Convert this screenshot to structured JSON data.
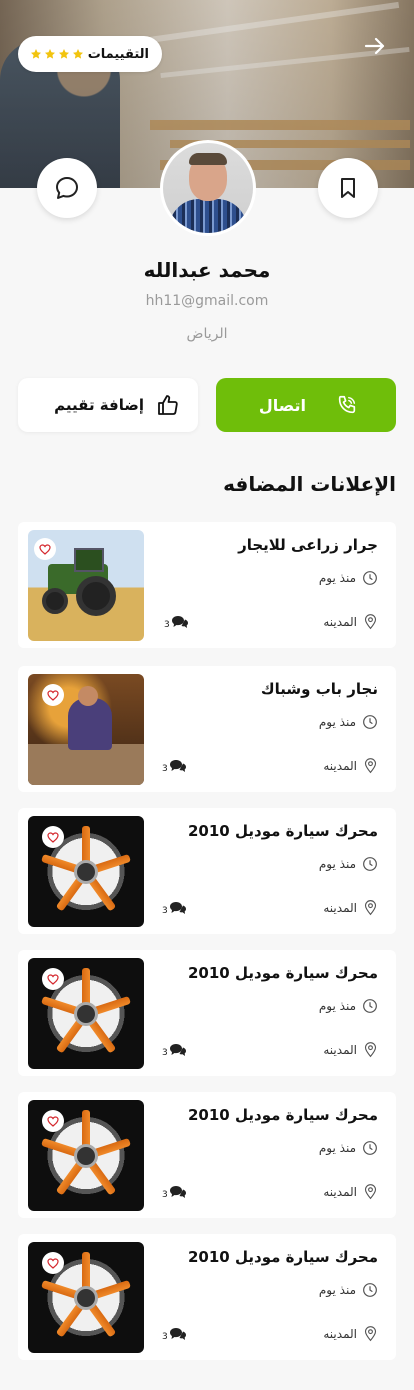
{
  "header": {
    "ratings_label": "التقييمات",
    "stars": 4,
    "star_color": "#f2c40f"
  },
  "profile": {
    "name": "محمد عبدالله",
    "email": "hh11@gmail.com",
    "city": "الرياض"
  },
  "actions": {
    "call_label": "اتصال",
    "rate_label": "إضافة تقييم",
    "accent_color": "#6fbe0a"
  },
  "ads_section": {
    "title": "الإعلانات المضافه"
  },
  "ads": [
    {
      "title": "جرار زراعى للايجار",
      "time": "منذ يوم",
      "location": "المدينه",
      "comments": "3",
      "image": "tractor-photo"
    },
    {
      "title": "نجار باب وشباك",
      "time": "منذ يوم",
      "location": "المدينه",
      "comments": "3",
      "image": "carpenter-photo"
    },
    {
      "title": "محرك سيارة موديل 2010",
      "time": "منذ يوم",
      "location": "المدينه",
      "comments": "3",
      "image": "wheel-photo"
    },
    {
      "title": "محرك سيارة موديل 2010",
      "time": "منذ يوم",
      "location": "المدينه",
      "comments": "3",
      "image": "wheel-photo"
    },
    {
      "title": "محرك سيارة موديل 2010",
      "time": "منذ يوم",
      "location": "المدينه",
      "comments": "3",
      "image": "wheel-photo"
    },
    {
      "title": "محرك سيارة موديل 2010",
      "time": "منذ يوم",
      "location": "المدينه",
      "comments": "3",
      "image": "wheel-photo"
    }
  ]
}
